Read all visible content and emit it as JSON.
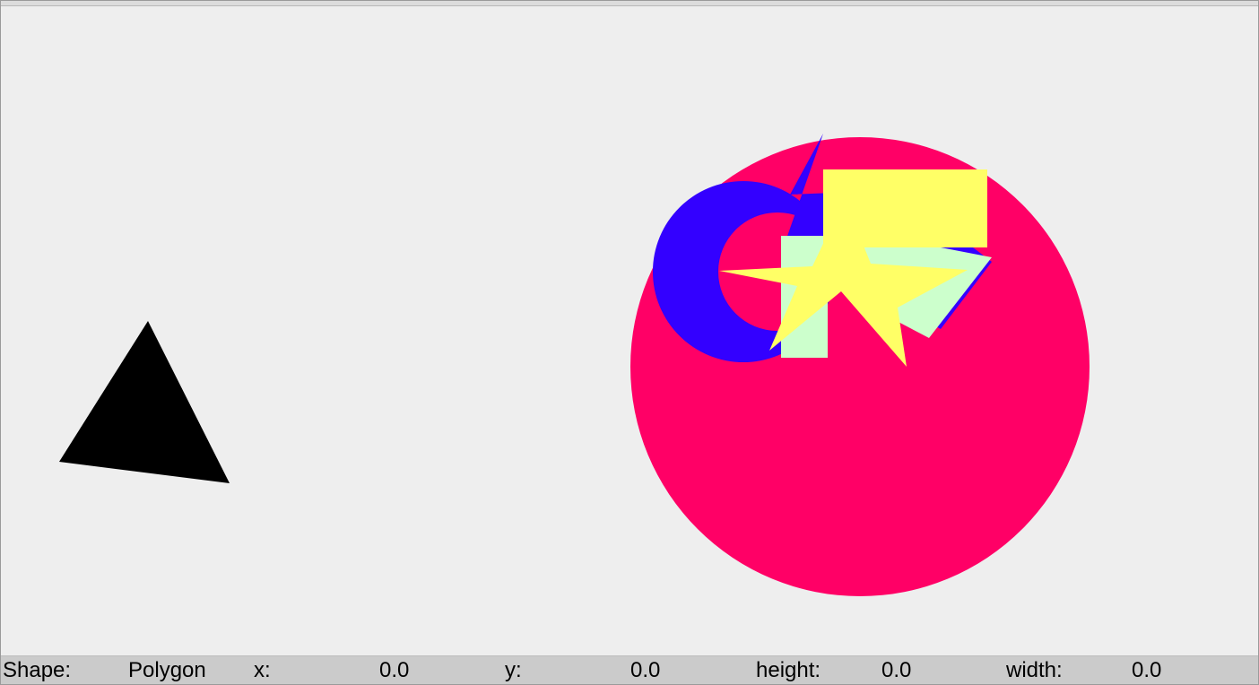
{
  "canvas": {
    "shapes": [
      {
        "name": "black-triangle",
        "kind": "polygon",
        "color": "#000000"
      },
      {
        "name": "pink-circle",
        "kind": "ellipse",
        "color": "#ff0066"
      },
      {
        "name": "blue-crescent",
        "kind": "ring",
        "color": "#3300ff"
      },
      {
        "name": "blue-polygon",
        "kind": "polygon",
        "color": "#3300ff"
      },
      {
        "name": "mint-polygon",
        "kind": "polygon",
        "color": "#ccffcc"
      },
      {
        "name": "mint-rectangle",
        "kind": "rectangle",
        "color": "#ccffcc"
      },
      {
        "name": "yellow-rectangle",
        "kind": "rectangle",
        "color": "#ffff66"
      },
      {
        "name": "yellow-star",
        "kind": "polygon",
        "color": "#ffff66"
      }
    ],
    "background": "#eeeeee"
  },
  "status": {
    "shape_label": "Shape:",
    "shape_value": "Polygon",
    "x_label": "x:",
    "x_value": "0.0",
    "y_label": "y:",
    "y_value": "0.0",
    "height_label": "height:",
    "height_value": "0.0",
    "width_label": "width:",
    "width_value": "0.0"
  }
}
